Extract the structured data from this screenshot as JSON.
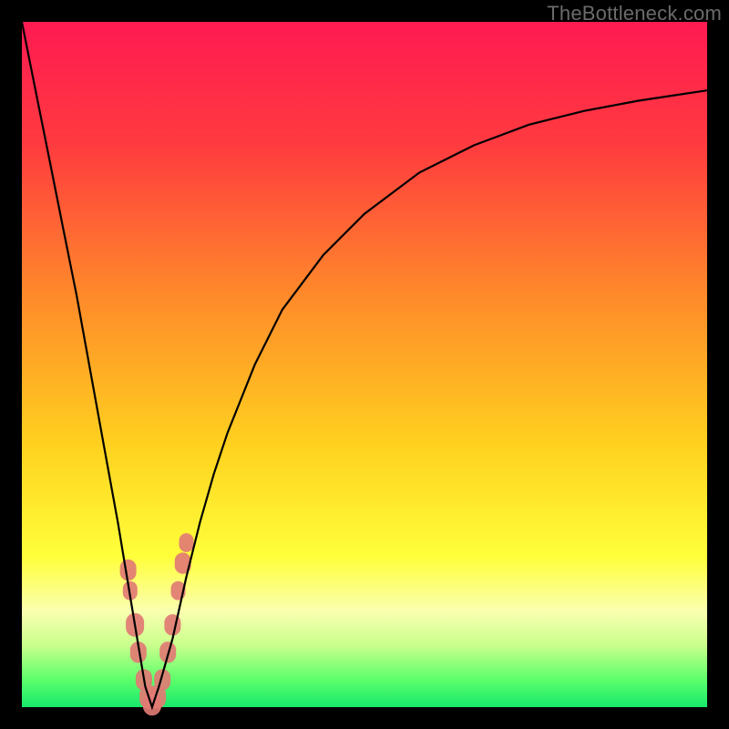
{
  "watermark": "TheBottleneck.com",
  "gradient": {
    "stops": [
      {
        "pct": 0,
        "color": "#ff1a52"
      },
      {
        "pct": 18,
        "color": "#ff3b3f"
      },
      {
        "pct": 40,
        "color": "#ff8a2a"
      },
      {
        "pct": 62,
        "color": "#ffd21f"
      },
      {
        "pct": 78,
        "color": "#ffff3a"
      },
      {
        "pct": 86,
        "color": "#faffb0"
      },
      {
        "pct": 91,
        "color": "#c9ff8c"
      },
      {
        "pct": 96,
        "color": "#5cff6b"
      },
      {
        "pct": 100,
        "color": "#17e86b"
      }
    ]
  },
  "chart_data": {
    "type": "line",
    "title": "",
    "xlabel": "",
    "ylabel": "",
    "xlim": [
      0,
      100
    ],
    "ylim": [
      0,
      100
    ],
    "series": [
      {
        "name": "bottleneck-curve",
        "x": [
          0,
          2,
          4,
          6,
          8,
          10,
          12,
          14,
          16,
          17,
          18,
          19,
          20,
          22,
          24,
          26,
          28,
          30,
          34,
          38,
          44,
          50,
          58,
          66,
          74,
          82,
          90,
          100
        ],
        "values": [
          100,
          90,
          80,
          70,
          60,
          49,
          38,
          27,
          15,
          9,
          3,
          0,
          3,
          10,
          19,
          27,
          34,
          40,
          50,
          58,
          66,
          72,
          78,
          82,
          85,
          87,
          88.5,
          90
        ]
      }
    ],
    "markers": {
      "name": "highlighted-points",
      "color": "#e17b74",
      "shape": "capsule",
      "points": [
        {
          "x": 15.5,
          "y": 20,
          "r": 9
        },
        {
          "x": 15.8,
          "y": 17,
          "r": 8
        },
        {
          "x": 16.5,
          "y": 12,
          "r": 10
        },
        {
          "x": 17.0,
          "y": 8,
          "r": 9
        },
        {
          "x": 17.8,
          "y": 4,
          "r": 9
        },
        {
          "x": 18.5,
          "y": 1.5,
          "r": 10
        },
        {
          "x": 19.0,
          "y": 0.5,
          "r": 10
        },
        {
          "x": 19.7,
          "y": 1.5,
          "r": 10
        },
        {
          "x": 20.5,
          "y": 4,
          "r": 9
        },
        {
          "x": 21.3,
          "y": 8,
          "r": 9
        },
        {
          "x": 22.0,
          "y": 12,
          "r": 9
        },
        {
          "x": 22.8,
          "y": 17,
          "r": 8
        },
        {
          "x": 23.5,
          "y": 21,
          "r": 9
        },
        {
          "x": 24.0,
          "y": 24,
          "r": 8
        }
      ]
    }
  }
}
